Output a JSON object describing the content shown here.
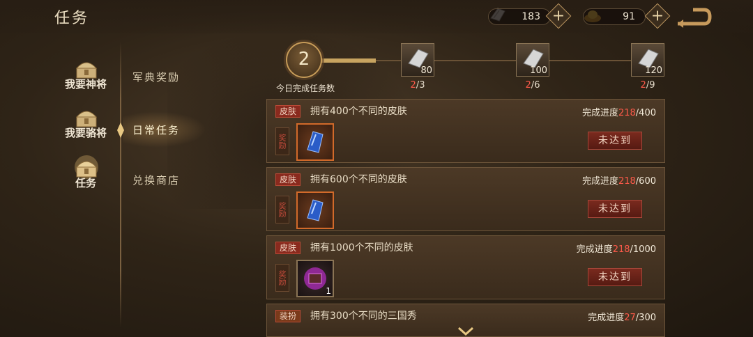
{
  "header": {
    "title": "任务",
    "resources": [
      {
        "icon": "silver-scroll-icon",
        "value": "183"
      },
      {
        "icon": "gold-ingot-icon",
        "value": "91"
      }
    ],
    "plus_label": "+"
  },
  "nav": {
    "items": [
      {
        "label": "我要神将",
        "icon": "chest-icon"
      },
      {
        "label": "我要骆将",
        "icon": "chest-icon"
      },
      {
        "label": "任务",
        "icon": "chest-icon",
        "active": true
      }
    ],
    "sub_items": [
      {
        "label": "军典奖励"
      },
      {
        "label": "日常任务",
        "active": true
      },
      {
        "label": "兑换商店"
      }
    ]
  },
  "daily": {
    "count": "2",
    "count_label": "今日完成任务数",
    "progress_fraction": 0.2,
    "milestones": [
      {
        "amount": "80",
        "current": "2",
        "target": "3"
      },
      {
        "amount": "100",
        "current": "2",
        "target": "6"
      },
      {
        "amount": "120",
        "current": "2",
        "target": "9"
      }
    ],
    "separator": "/"
  },
  "tasks": [
    {
      "tag": "皮肤",
      "title": "拥有400个不同的皮肤",
      "progress_label": "完成进度",
      "current": "218",
      "target": "400",
      "reward_label": "奖励",
      "reward_icon": "blue-gem-icon",
      "reward_qty": "",
      "status": "未达到"
    },
    {
      "tag": "皮肤",
      "title": "拥有600个不同的皮肤",
      "progress_label": "完成进度",
      "current": "218",
      "target": "600",
      "reward_label": "奖励",
      "reward_icon": "blue-gem-icon",
      "reward_qty": "",
      "status": "未达到"
    },
    {
      "tag": "皮肤",
      "title": "拥有1000个不同的皮肤",
      "progress_label": "完成进度",
      "current": "218",
      "target": "1000",
      "reward_label": "奖励",
      "reward_icon": "purple-chest-icon",
      "reward_qty": "1",
      "status": "未达到"
    },
    {
      "tag": "装扮",
      "title": "拥有300个不同的三国秀",
      "progress_label": "完成进度",
      "current": "27",
      "target": "300"
    }
  ],
  "colors": {
    "accent": "#c8a460",
    "alert": "#ff5a4a",
    "button": "#7a2a1e"
  }
}
